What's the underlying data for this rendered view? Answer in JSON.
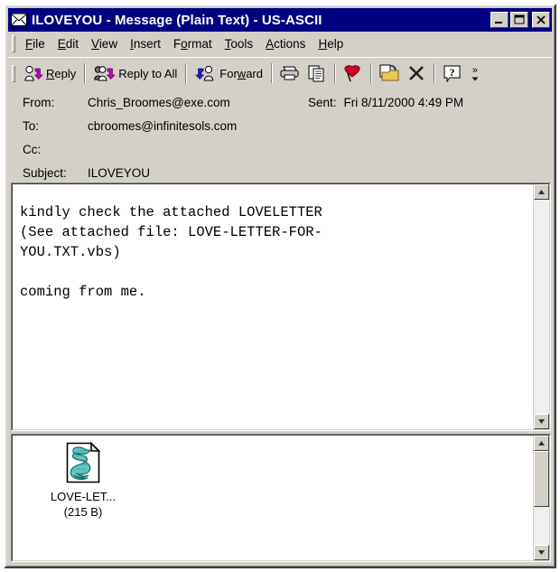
{
  "window": {
    "title": "ILOVEYOU - Message (Plain Text)  - US-ASCII",
    "icon": "envelope-icon",
    "controls": {
      "minimize": "minimize-button",
      "maximize": "maximize-button",
      "close": "close-button"
    },
    "colors": {
      "titlebar": "#000080",
      "titlebar_text": "#ffffff",
      "face": "#d4d0c8",
      "client": "#ffffff",
      "shadow": "#808080",
      "attachment_icon": "#3aa8a0"
    }
  },
  "menubar": {
    "items": [
      {
        "label": "File",
        "accel": "F"
      },
      {
        "label": "Edit",
        "accel": "E"
      },
      {
        "label": "View",
        "accel": "V"
      },
      {
        "label": "Insert",
        "accel": "I"
      },
      {
        "label": "Format",
        "accel": "o"
      },
      {
        "label": "Tools",
        "accel": "T"
      },
      {
        "label": "Actions",
        "accel": "A"
      },
      {
        "label": "Help",
        "accel": "H"
      }
    ]
  },
  "toolbar": {
    "reply_label": "Reply",
    "reply_all_label": "Reply to All",
    "forward_label": "Forward",
    "print_label": "print-icon",
    "copy_label": "copy-icon",
    "flag_label": "flag-icon",
    "move_label": "move-to-folder-icon",
    "delete_label": "delete-icon",
    "help_label": "help-icon",
    "overflow_label": "»"
  },
  "headers": {
    "from_label": "From:",
    "from_value": "Chris_Broomes@exe.com",
    "to_label": "To:",
    "to_value": "cbroomes@infinitesols.com",
    "cc_label": "Cc:",
    "cc_value": "",
    "subject_label": "Subject:",
    "subject_value": "ILOVEYOU",
    "sent_label": "Sent:",
    "sent_value": "Fri 8/11/2000 4:49 PM"
  },
  "body": {
    "text": "kindly check the attached LOVELETTER\n(See attached file: LOVE-LETTER-FOR-\nYOU.TXT.vbs)\n\ncoming from me."
  },
  "attachment": {
    "icon": "vbscript-file-icon",
    "name": "LOVE-LET...",
    "size": "(215 B)"
  }
}
